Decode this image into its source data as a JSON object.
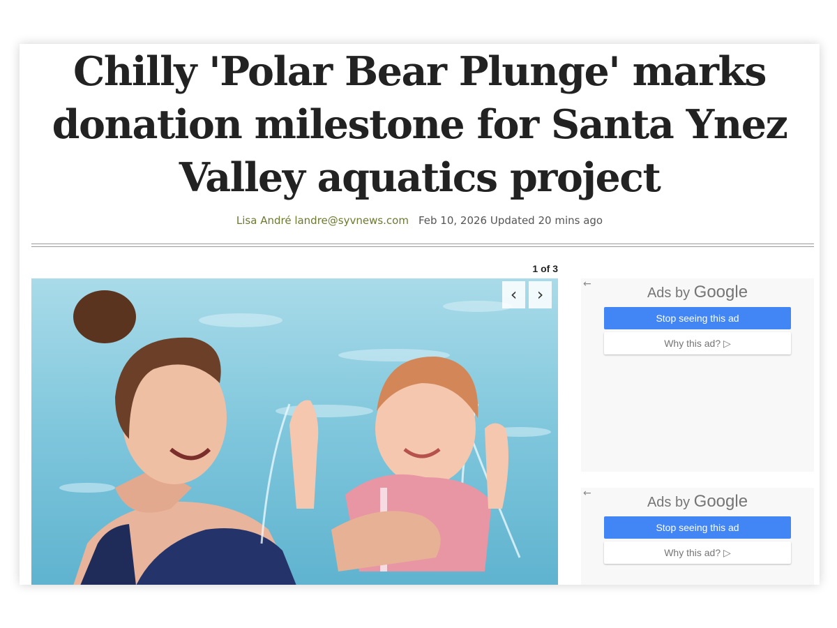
{
  "article": {
    "headline": "Chilly 'Polar Bear Plunge' marks donation milestone for Santa Ynez Valley aquatics project",
    "author": "Lisa André landre@syvnews.com",
    "dateline": "Feb 10, 2026 Updated 20 mins ago"
  },
  "gallery": {
    "counter": "1 of 3",
    "prev_icon": "‹",
    "next_icon": "›"
  },
  "ads": [
    {
      "back_icon": "←",
      "ads_by": "Ads by",
      "brand": "Google",
      "stop_label": "Stop seeing this ad",
      "why_label": "Why this ad? ▷"
    },
    {
      "back_icon": "←",
      "ads_by": "Ads by",
      "brand": "Google",
      "stop_label": "Stop seeing this ad",
      "why_label": "Why this ad? ▷"
    }
  ],
  "colors": {
    "author_link": "#6b7a2e",
    "ad_button_blue": "#4285f4",
    "pool_water": "#7fc6dc"
  }
}
